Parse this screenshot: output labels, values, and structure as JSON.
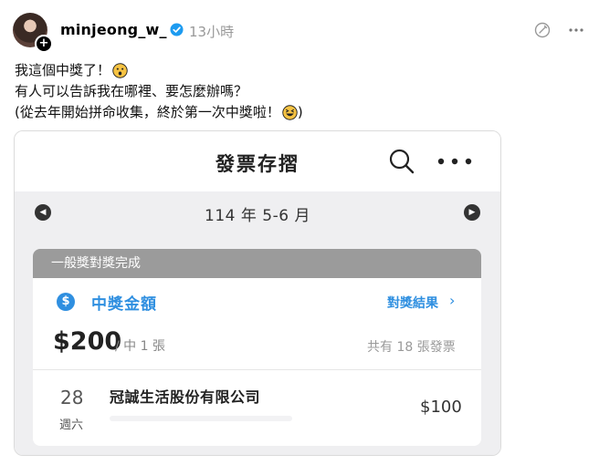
{
  "post": {
    "username": "minjeong_w_",
    "timestamp": "13小時",
    "caption": {
      "line1": "我這個中獎了！",
      "line2": "有人可以告訴我在哪裡、要怎麼辦嗎？",
      "line3_start": "(從去年開始拼命收集，終於第一次中獎啦！",
      "line3_end": ")"
    },
    "icons": {
      "avatar": "profile-photo",
      "follow": "plus-icon",
      "verified": "verified-badge-icon",
      "edit": "edit-icon",
      "more": "more-options-icon",
      "emoji1": "surprised-face-emoji",
      "emoji2": "grinning-squinting-face-emoji"
    },
    "colors": {
      "verified": "#1d9bf0",
      "timestamp": "#999999"
    }
  },
  "screenshot": {
    "header": {
      "title": "發票存摺",
      "search_icon": "search-icon",
      "menu_icon": "more-icon"
    },
    "period": {
      "label": "114 年 5-6 月",
      "prev_icon": "chevron-left-icon",
      "next_icon": "chevron-right-icon"
    },
    "prize": {
      "status": "一般獎對獎完成",
      "label": "中獎金額",
      "link_label": "對獎結果",
      "link_chevron": "›",
      "amount": "$200",
      "count": "/ 中 1 張",
      "total": "共有 18 張發票",
      "icon": "dollar-icon",
      "accent": "#2f8fe0"
    },
    "invoice": {
      "day": "28",
      "weekday": "週六",
      "company": "冠誠生活股份有限公司",
      "amount": "$100"
    }
  }
}
